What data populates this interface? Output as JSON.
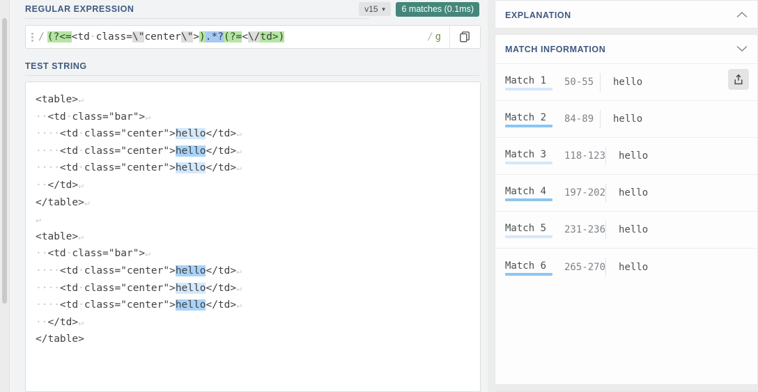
{
  "regex_section": {
    "title": "REGULAR EXPRESSION",
    "flavor": "v15",
    "flavor_caret": "chevron-down",
    "match_badge": "6 matches (0.1ms)",
    "badge_color": "#44877a",
    "open_delimiter": "/",
    "close_delimiter": "/",
    "flags": "g",
    "pattern_full": "(?<=<td class=\\\"center\\\">).*?(?=<\\/td>)",
    "pattern_tokens": [
      {
        "text": "(?<=",
        "hl": "green"
      },
      {
        "text": "<td",
        "hl": "none"
      },
      {
        "text": "·",
        "hl": "dot"
      },
      {
        "text": "class=",
        "hl": "none"
      },
      {
        "text": "\\\"",
        "hl": "gray"
      },
      {
        "text": "center",
        "hl": "none"
      },
      {
        "text": "\\\"",
        "hl": "gray"
      },
      {
        "text": ">",
        "hl": "none"
      },
      {
        "text": ")",
        "hl": "green"
      },
      {
        "text": ".*?",
        "hl": "blue"
      },
      {
        "text": "(?=",
        "hl": "green"
      },
      {
        "text": "<",
        "hl": "none"
      },
      {
        "text": "\\/",
        "hl": "gray"
      },
      {
        "text": "td>",
        "hl": "green"
      },
      {
        "text": ")",
        "hl": "green"
      }
    ],
    "copy_icon": "copy-icon"
  },
  "test_string_section": {
    "title": "TEST STRING",
    "lines": [
      [
        {
          "t": "<table>",
          "k": "plain"
        },
        {
          "t": "↵",
          "k": "crlf"
        }
      ],
      [
        {
          "t": "··",
          "k": "dot"
        },
        {
          "t": "<td",
          "k": "plain"
        },
        {
          "t": "·",
          "k": "dot"
        },
        {
          "t": "class=\"bar\">",
          "k": "plain"
        },
        {
          "t": "↵",
          "k": "crlf"
        }
      ],
      [
        {
          "t": "····",
          "k": "dot"
        },
        {
          "t": "<td",
          "k": "plain"
        },
        {
          "t": "·",
          "k": "dot"
        },
        {
          "t": "class=\"center\">",
          "k": "plain"
        },
        {
          "t": "hello",
          "k": "m-a"
        },
        {
          "t": "</td>",
          "k": "plain"
        },
        {
          "t": "↵",
          "k": "crlf"
        }
      ],
      [
        {
          "t": "····",
          "k": "dot"
        },
        {
          "t": "<td",
          "k": "plain"
        },
        {
          "t": "·",
          "k": "dot"
        },
        {
          "t": "class=\"center\">",
          "k": "plain"
        },
        {
          "t": "hello",
          "k": "m-b"
        },
        {
          "t": "</td>",
          "k": "plain"
        },
        {
          "t": "↵",
          "k": "crlf"
        }
      ],
      [
        {
          "t": "····",
          "k": "dot"
        },
        {
          "t": "<td",
          "k": "plain"
        },
        {
          "t": "·",
          "k": "dot"
        },
        {
          "t": "class=\"center\">",
          "k": "plain"
        },
        {
          "t": "hello",
          "k": "m-a"
        },
        {
          "t": "</td>",
          "k": "plain"
        },
        {
          "t": "↵",
          "k": "crlf"
        }
      ],
      [
        {
          "t": "··",
          "k": "dot"
        },
        {
          "t": "</td>",
          "k": "plain"
        },
        {
          "t": "↵",
          "k": "crlf"
        }
      ],
      [
        {
          "t": "</table>",
          "k": "plain"
        },
        {
          "t": "↵",
          "k": "crlf"
        }
      ],
      [
        {
          "t": "↵",
          "k": "crlf"
        }
      ],
      [
        {
          "t": "<table>",
          "k": "plain"
        },
        {
          "t": "↵",
          "k": "crlf"
        }
      ],
      [
        {
          "t": "··",
          "k": "dot"
        },
        {
          "t": "<td",
          "k": "plain"
        },
        {
          "t": "·",
          "k": "dot"
        },
        {
          "t": "class=\"bar\">",
          "k": "plain"
        },
        {
          "t": "↵",
          "k": "crlf"
        }
      ],
      [
        {
          "t": "····",
          "k": "dot"
        },
        {
          "t": "<td",
          "k": "plain"
        },
        {
          "t": "·",
          "k": "dot"
        },
        {
          "t": "class=\"center\">",
          "k": "plain"
        },
        {
          "t": "hello",
          "k": "m-b"
        },
        {
          "t": "</td>",
          "k": "plain"
        },
        {
          "t": "↵",
          "k": "crlf"
        }
      ],
      [
        {
          "t": "····",
          "k": "dot"
        },
        {
          "t": "<td",
          "k": "plain"
        },
        {
          "t": "·",
          "k": "dot"
        },
        {
          "t": "class=\"center\">",
          "k": "plain"
        },
        {
          "t": "hello",
          "k": "m-a"
        },
        {
          "t": "</td>",
          "k": "plain"
        },
        {
          "t": "↵",
          "k": "crlf"
        }
      ],
      [
        {
          "t": "····",
          "k": "dot"
        },
        {
          "t": "<td",
          "k": "plain"
        },
        {
          "t": "·",
          "k": "dot"
        },
        {
          "t": "class=\"center\">",
          "k": "plain"
        },
        {
          "t": "hello",
          "k": "m-b"
        },
        {
          "t": "</td>",
          "k": "plain"
        },
        {
          "t": "↵",
          "k": "crlf"
        }
      ],
      [
        {
          "t": "··",
          "k": "dot"
        },
        {
          "t": "</td>",
          "k": "plain"
        },
        {
          "t": "↵",
          "k": "crlf"
        }
      ],
      [
        {
          "t": "</table>",
          "k": "plain"
        }
      ]
    ]
  },
  "explanation_panel": {
    "title": "EXPLANATION",
    "collapse_icon": "chevron-up"
  },
  "match_information_panel": {
    "title": "MATCH INFORMATION",
    "collapse_icon": "chevron-down",
    "export_icon": "export-icon",
    "matches": [
      {
        "label": "Match 1",
        "range": "50-55",
        "value": "hello",
        "underline": "#d4e8fb"
      },
      {
        "label": "Match 2",
        "range": "84-89",
        "value": "hello",
        "underline": "#8cc5f2"
      },
      {
        "label": "Match 3",
        "range": "118-123",
        "value": "hello",
        "underline": "#d4e8fb"
      },
      {
        "label": "Match 4",
        "range": "197-202",
        "value": "hello",
        "underline": "#8cc5f2"
      },
      {
        "label": "Match 5",
        "range": "231-236",
        "value": "hello",
        "underline": "#d4e8fb"
      },
      {
        "label": "Match 6",
        "range": "265-270",
        "value": "hello",
        "underline": "#8cc5f2"
      }
    ]
  }
}
